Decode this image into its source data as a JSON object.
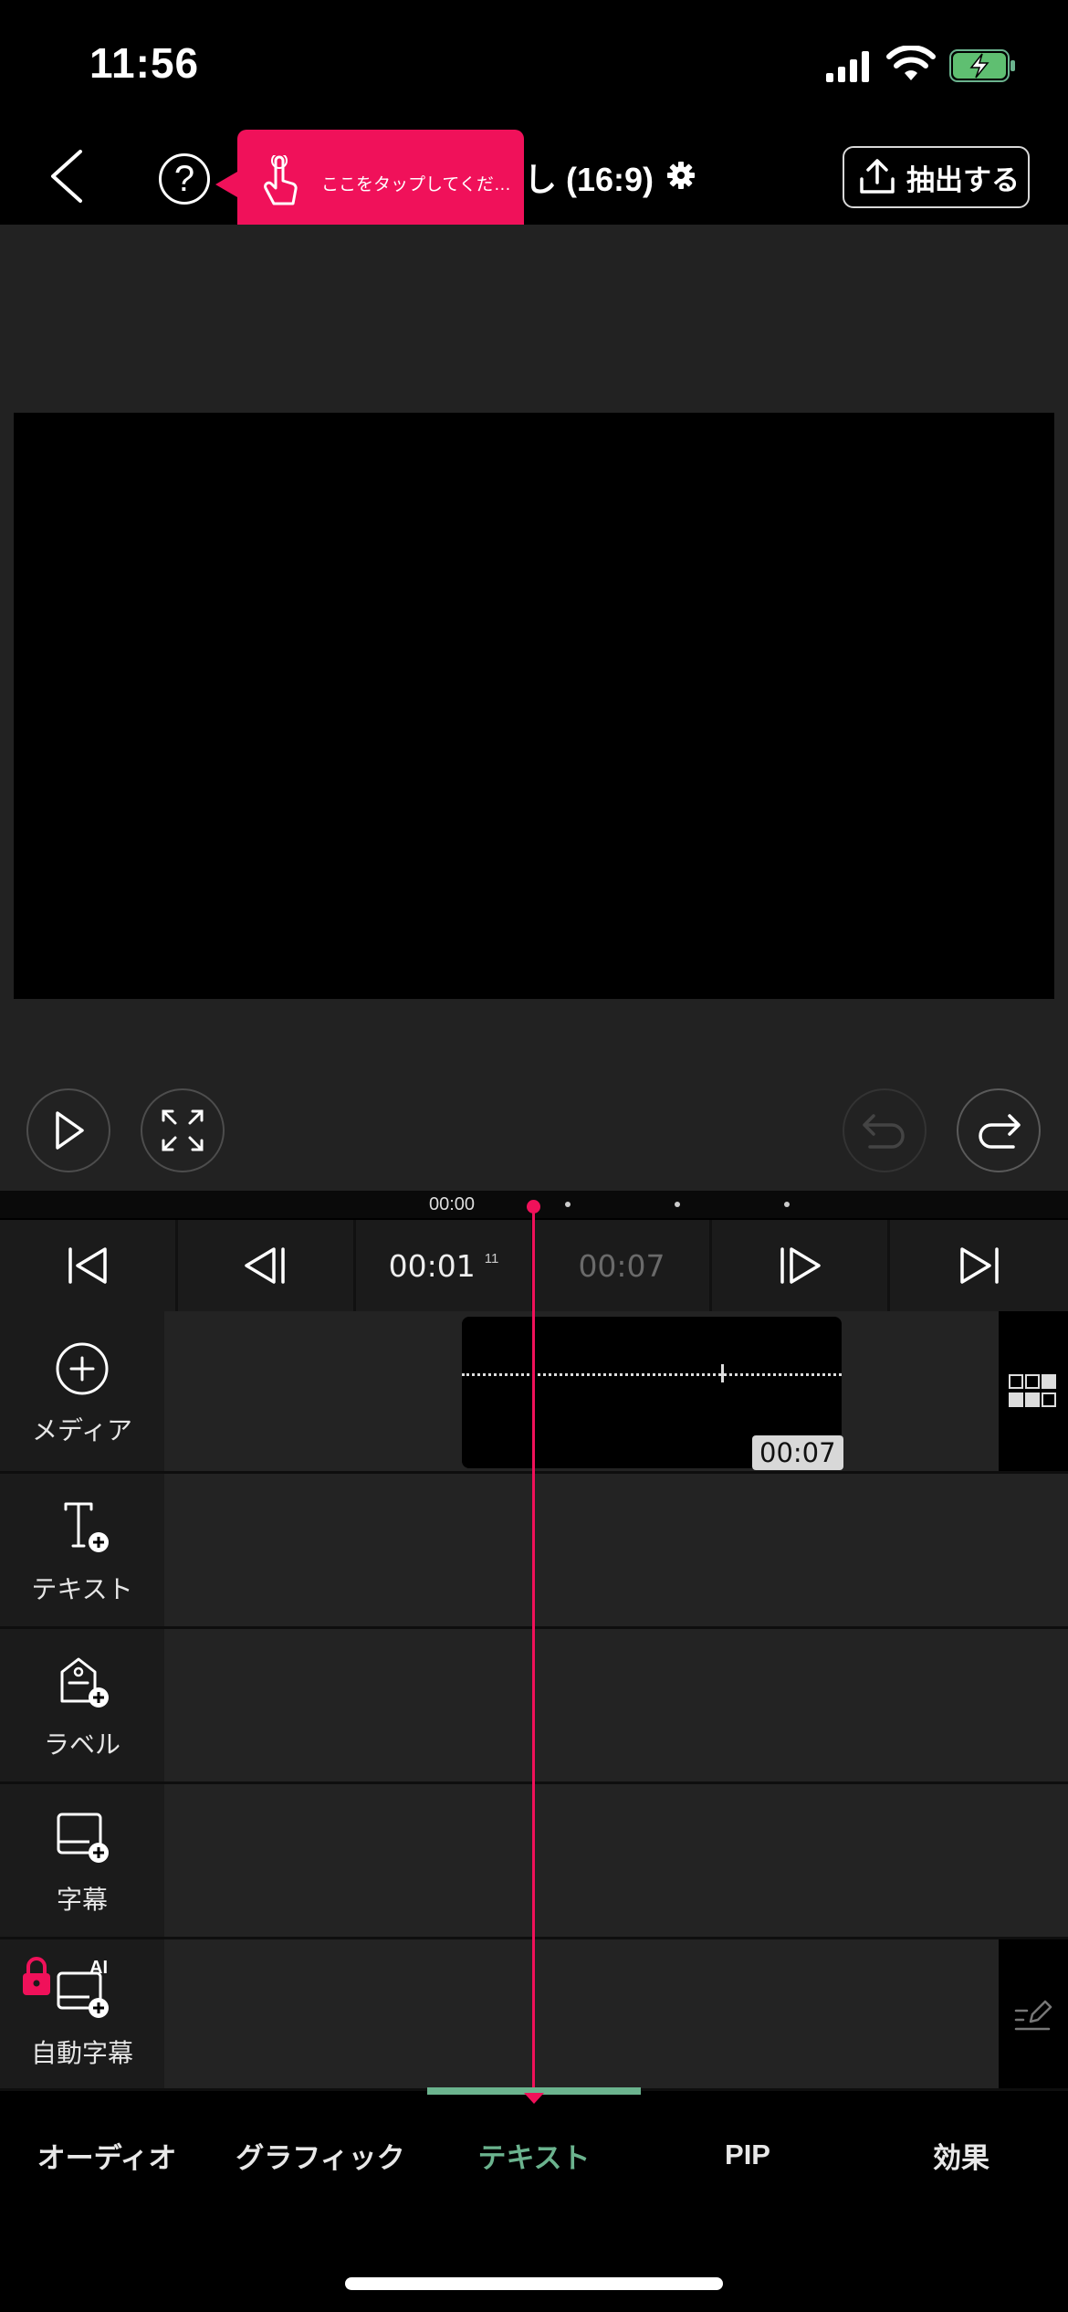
{
  "status_bar": {
    "time": "11:56"
  },
  "header": {
    "tooltip_text": "ここをタップしてくだ…",
    "project_title": "し (16:9)",
    "export_label": "抽出する"
  },
  "timeline": {
    "ruler_time": "00:00",
    "current_time": "00:01",
    "current_frames": "11",
    "total_time": "00:07",
    "clip_duration": "00:07"
  },
  "tracks": [
    {
      "label": "メディア",
      "icon": "plus-circle-icon"
    },
    {
      "label": "テキスト",
      "icon": "text-add-icon"
    },
    {
      "label": "ラベル",
      "icon": "label-add-icon"
    },
    {
      "label": "字幕",
      "icon": "subtitle-add-icon"
    },
    {
      "label": "自動字幕",
      "icon": "ai-subtitle-icon",
      "badge": "AI"
    }
  ],
  "tabs": [
    {
      "label": "オーディオ"
    },
    {
      "label": "グラフィック"
    },
    {
      "label": "テキスト",
      "active": true
    },
    {
      "label": "PIP"
    },
    {
      "label": "効果"
    }
  ],
  "colors": {
    "accent": "#f0115a",
    "active_tab": "#6bb38e"
  }
}
